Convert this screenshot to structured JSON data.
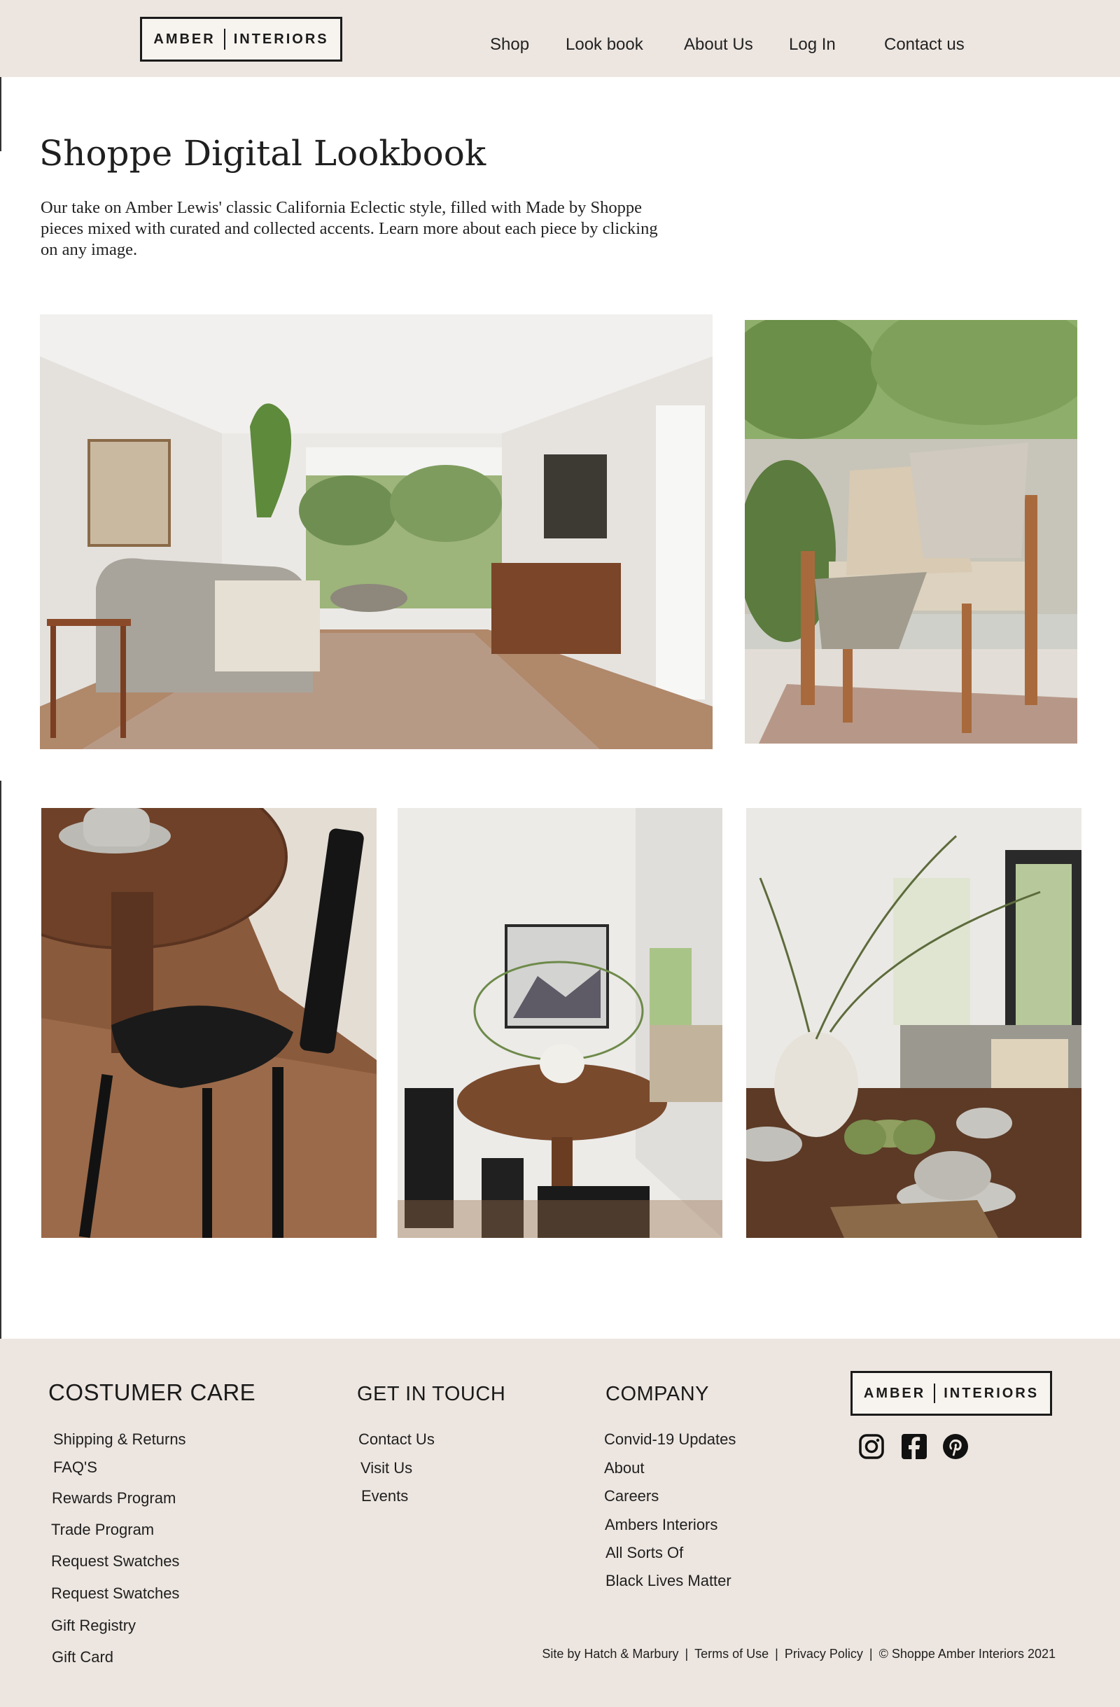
{
  "header": {
    "logo": {
      "left": "AMBER",
      "right": "INTERIORS"
    },
    "nav": [
      "Shop",
      "Look book",
      "About Us",
      "Log In",
      "Contact us"
    ]
  },
  "intro": {
    "title": "Shoppe Digital Lookbook",
    "description": "Our take on Amber Lewis' classic California Eclectic style, filled with Made by Shoppe pieces mixed with curated and collected accents. Learn more about each piece by clicking on any image."
  },
  "footer": {
    "customer_care": {
      "heading": "COSTUMER  CARE",
      "links": [
        "Shipping & Returns",
        "FAQ'S",
        "Rewards Program",
        "Trade Program",
        "Request Swatches",
        "Request Swatches",
        "Gift Registry",
        "Gift Card"
      ]
    },
    "get_in_touch": {
      "heading": "GET IN TOUCH",
      "links": [
        "Contact Us",
        "Visit Us",
        "Events"
      ]
    },
    "company": {
      "heading": "COMPANY",
      "links": [
        "Convid-19 Updates",
        "About",
        "Careers",
        "Ambers Interiors",
        "All Sorts Of",
        "Black Lives Matter"
      ]
    },
    "logo": {
      "left": "AMBER",
      "right": "INTERIORS"
    },
    "social": [
      "instagram-icon",
      "facebook-icon",
      "pinterest-icon"
    ],
    "legal": {
      "credit": "Site by Hatch & Marbury",
      "terms": "Terms of Use",
      "privacy": "Privacy Policy",
      "copyright": "© Shoppe Amber Interiors 2021",
      "separator": "|"
    }
  },
  "colors": {
    "header_bg": "#ede6e0",
    "footer_bg": "#ede6e0",
    "text": "#1a1a1a"
  }
}
